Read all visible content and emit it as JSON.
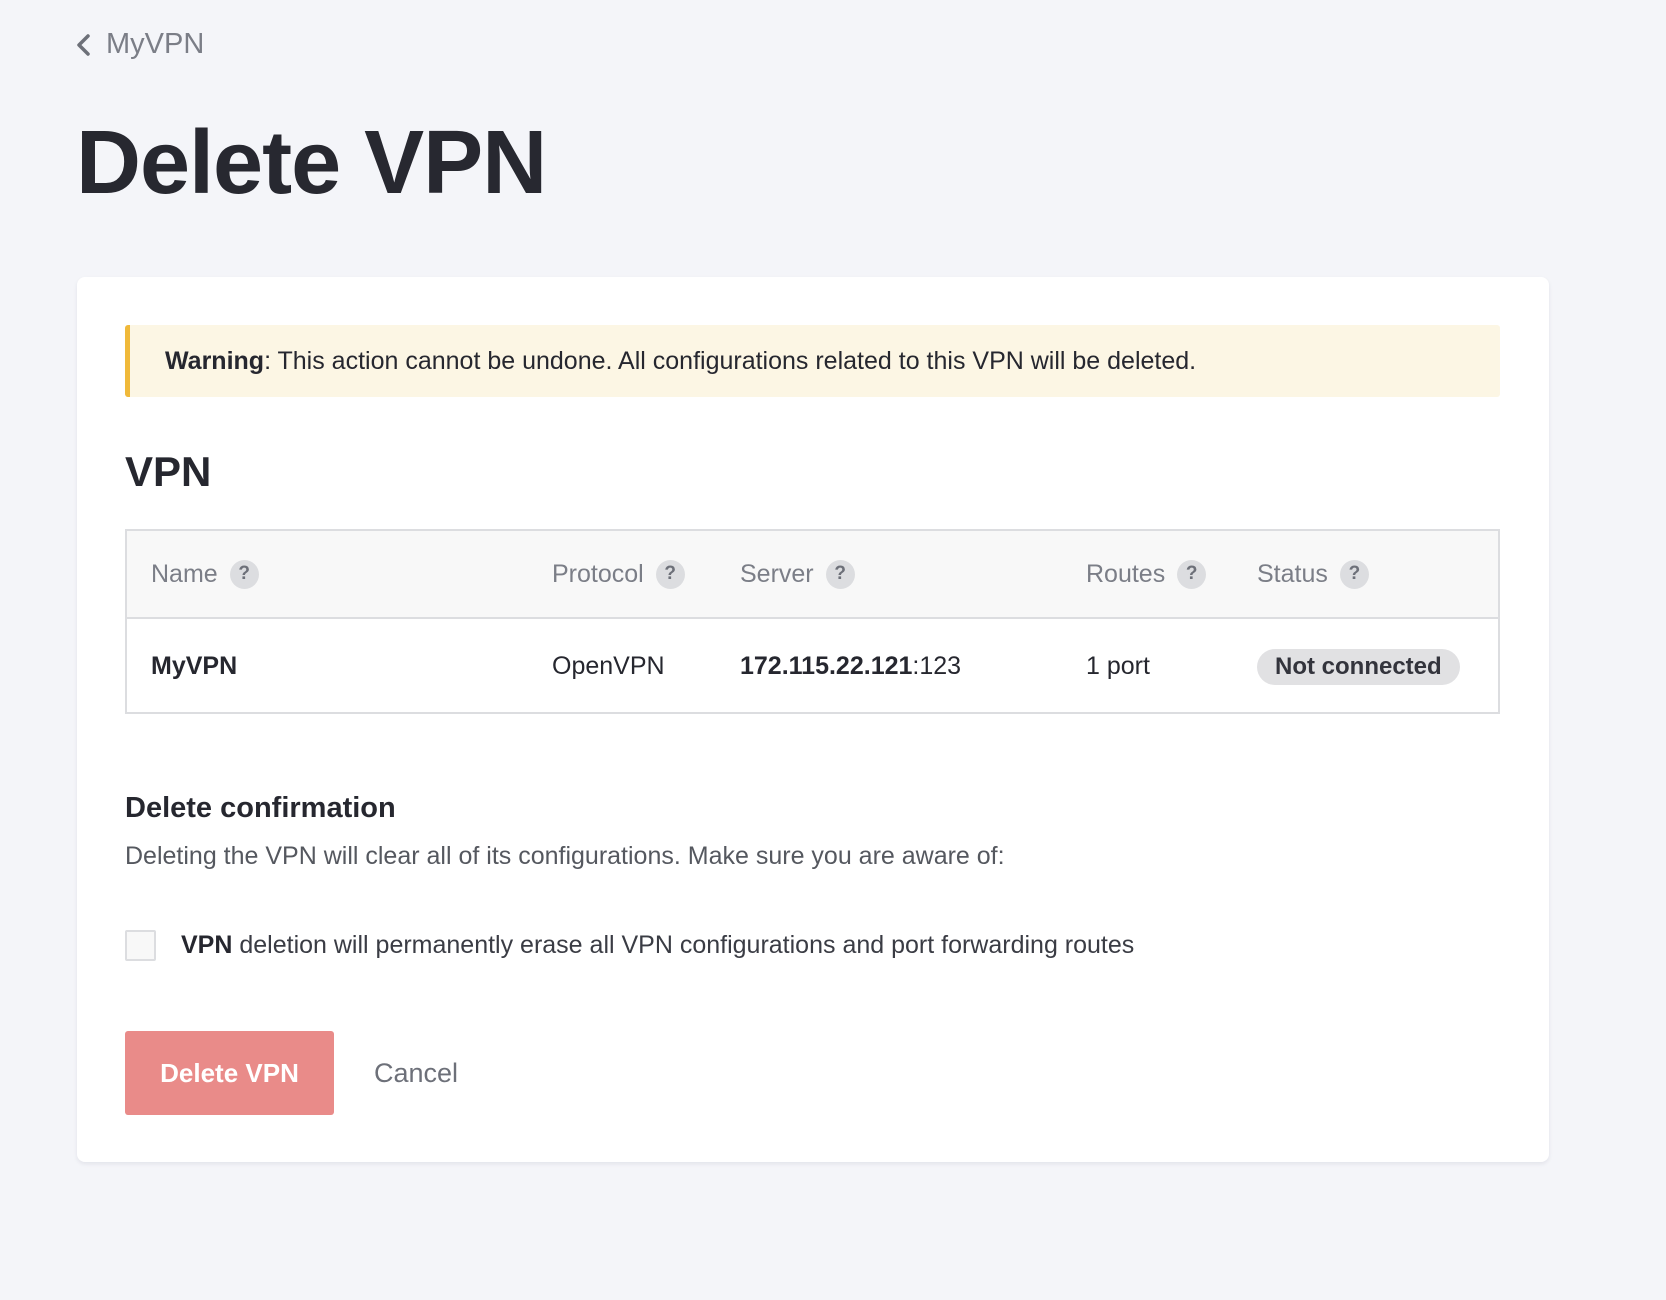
{
  "breadcrumb": {
    "label": "MyVPN",
    "icon": "chevron-left-icon"
  },
  "page": {
    "title": "Delete VPN"
  },
  "warning": {
    "label": "Warning",
    "text": ": This action cannot be undone. All configurations related to this VPN will be deleted.",
    "accent_color": "#f0b93a"
  },
  "vpn_section": {
    "title": "VPN",
    "columns": [
      {
        "label": "Name",
        "help": "?"
      },
      {
        "label": "Protocol",
        "help": "?"
      },
      {
        "label": "Server",
        "help": "?"
      },
      {
        "label": "Routes",
        "help": "?"
      },
      {
        "label": "Status",
        "help": "?"
      }
    ],
    "row": {
      "name": "MyVPN",
      "protocol": "OpenVPN",
      "server_ip": "172.115.22.121",
      "server_port": ":123",
      "routes": "1 port",
      "status": "Not connected"
    }
  },
  "confirmation": {
    "title": "Delete confirmation",
    "description": "Deleting the VPN will clear all of its configurations. Make sure you are aware of:",
    "checkbox_bold": "VPN",
    "checkbox_text": " deletion will permanently erase all VPN configurations and port forwarding routes",
    "checked": false
  },
  "actions": {
    "delete_label": "Delete VPN",
    "cancel_label": "Cancel",
    "delete_color": "#e98b89"
  }
}
